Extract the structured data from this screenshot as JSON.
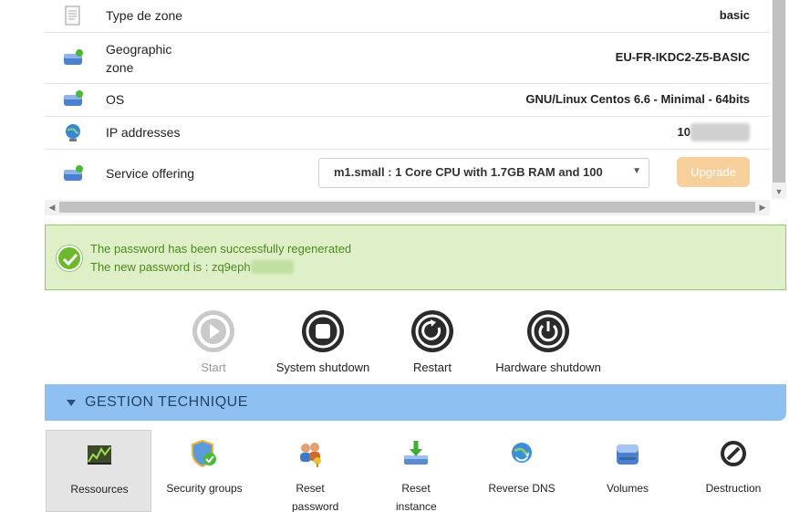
{
  "details": {
    "rows": [
      {
        "label": "Type de zone",
        "value": "basic",
        "icon": "document-icon"
      },
      {
        "label": "Geographic zone",
        "value": "EU-FR-IKDC2-Z5-BASIC",
        "icon": "server-icon"
      },
      {
        "label": "OS",
        "value": "GNU/Linux Centos 6.6 - Minimal - 64bits",
        "icon": "server-icon"
      },
      {
        "label": "IP addresses",
        "value": "10",
        "icon": "globe-icon"
      },
      {
        "label": "Service offering",
        "icon": "server-icon"
      }
    ],
    "geo_label_line1": "Geographic",
    "geo_label_line2": "zone",
    "service_select": "m1.small : 1 Core CPU with 1.7GB RAM and 100",
    "upgrade_label": "Upgrade"
  },
  "alert": {
    "line1": "The password has been successfully regenerated",
    "line2": "The new password is : zq9eph"
  },
  "power": {
    "start": "Start",
    "system_shutdown": "System shutdown",
    "restart": "Restart",
    "hardware_shutdown": "Hardware shutdown"
  },
  "section": {
    "title": "GESTION TECHNIQUE"
  },
  "tools": [
    {
      "label": "Ressources",
      "icon": "chart-icon"
    },
    {
      "label": "Security groups",
      "icon": "shield-icon"
    },
    {
      "label": "Reset password",
      "icon": "users-key-icon"
    },
    {
      "label": "Reset instance",
      "icon": "reset-instance-icon"
    },
    {
      "label": "Reverse DNS",
      "icon": "globe-dns-icon"
    },
    {
      "label": "Volumes",
      "icon": "disk-icon"
    },
    {
      "label": "Destruction",
      "icon": "forbidden-icon"
    }
  ],
  "colors": {
    "alert_bg": "#dff0c9",
    "alert_text": "#4c8a1e",
    "section_bg": "#8ec0f2",
    "upgrade_bg": "#f7cf9a"
  }
}
